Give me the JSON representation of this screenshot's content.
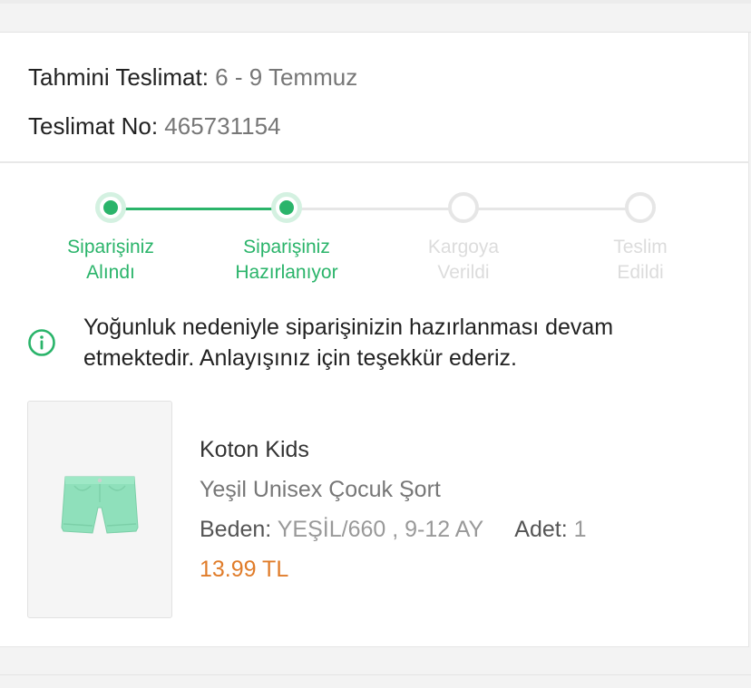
{
  "delivery": {
    "estimate_label": "Tahmini Teslimat:",
    "estimate_value": "6 - 9 Temmuz",
    "number_label": "Teslimat No:",
    "number_value": "465731154"
  },
  "stepper": {
    "active_color": "#2ab46a",
    "inactive_color": "#dcdcdc",
    "steps": [
      {
        "line1": "Siparişiniz",
        "line2": "Alındı",
        "state": "active"
      },
      {
        "line1": "Siparişiniz",
        "line2": "Hazırlanıyor",
        "state": "active"
      },
      {
        "line1": "Kargoya",
        "line2": "Verildi",
        "state": "inactive"
      },
      {
        "line1": "Teslim",
        "line2": "Edildi",
        "state": "inactive"
      }
    ]
  },
  "notice": {
    "icon": "info-icon",
    "text_line1": "Yoğunluk nedeniyle siparişinizin hazırlanması devam",
    "text_line2": "etmektedir. Anlayışınız için teşekkür ederiz."
  },
  "product": {
    "image_icon": "shorts-icon",
    "brand": "Koton Kids",
    "name": "Yeşil Unisex Çocuk Şort",
    "size_label": "Beden:",
    "size_value": "YEŞİL/660 , 9-12 AY",
    "qty_label": "Adet:",
    "qty_value": "1",
    "price": "13.99 TL",
    "price_color": "#e07c2a"
  }
}
